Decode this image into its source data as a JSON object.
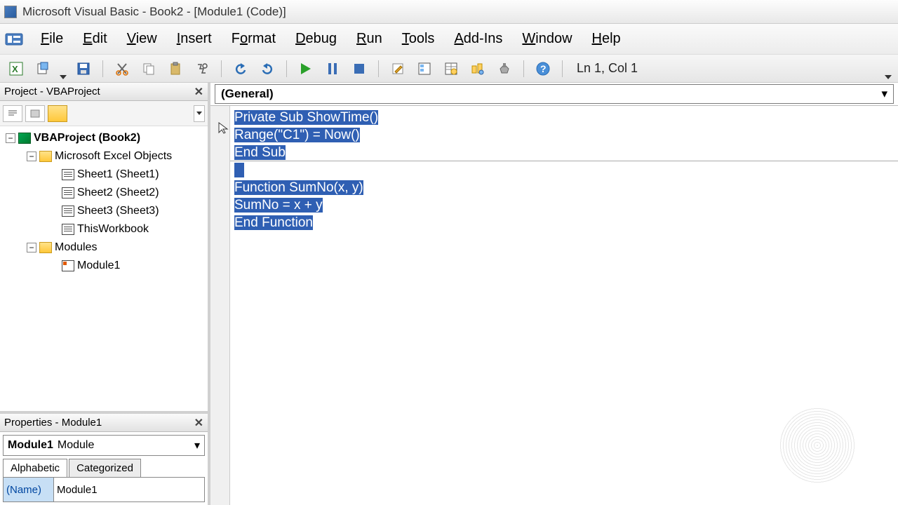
{
  "titlebar": {
    "title": "Microsoft Visual Basic - Book2 - [Module1 (Code)]"
  },
  "menus": [
    "File",
    "Edit",
    "View",
    "Insert",
    "Format",
    "Debug",
    "Run",
    "Tools",
    "Add-Ins",
    "Window",
    "Help"
  ],
  "toolbar": {
    "position": "Ln 1, Col 1"
  },
  "project_pane": {
    "title": "Project - VBAProject",
    "root": "VBAProject (Book2)",
    "excel_group": "Microsoft Excel Objects",
    "sheets": [
      "Sheet1 (Sheet1)",
      "Sheet2 (Sheet2)",
      "Sheet3 (Sheet3)"
    ],
    "thisworkbook": "ThisWorkbook",
    "modules_group": "Modules",
    "module1": "Module1"
  },
  "properties_pane": {
    "title": "Properties - Module1",
    "obj_name": "Module1",
    "obj_type": "Module",
    "tabs": [
      "Alphabetic",
      "Categorized"
    ],
    "name_key": "(Name)",
    "name_val": "Module1"
  },
  "code_combo": "(General)",
  "code_lines": [
    "Private Sub ShowTime()",
    "Range(\"C1\") = Now()",
    "End Sub",
    "",
    "Function SumNo(x, y)",
    "SumNo = x + y",
    "End Function"
  ]
}
